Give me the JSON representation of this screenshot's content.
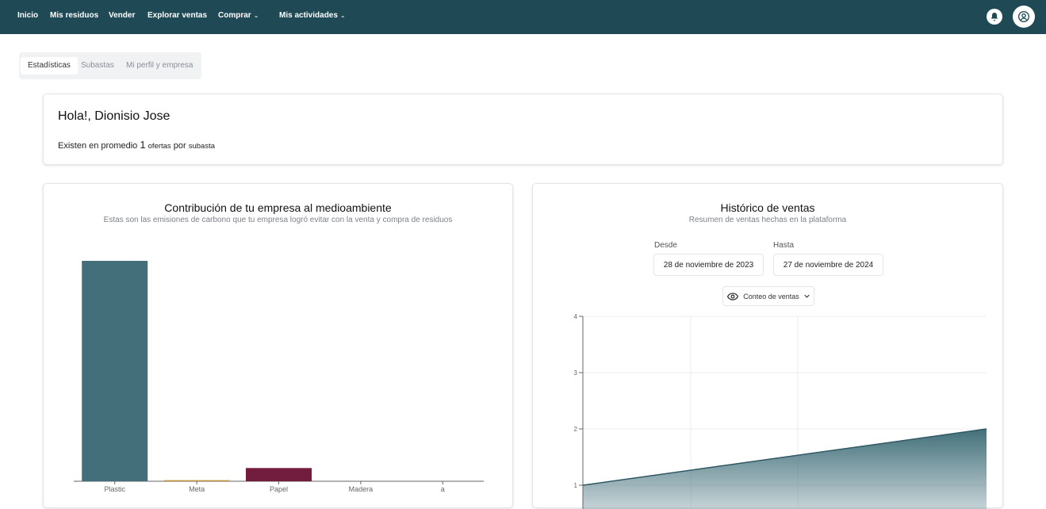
{
  "nav": {
    "items": [
      "Inicio",
      "Mis residuos",
      "Vender",
      "Explorar ventas"
    ],
    "comprar": "Comprar",
    "mis_actividades": "Mis actividades",
    "chevron": "⌄"
  },
  "icons": {
    "bell": "bell-icon",
    "profile": "user-circle-icon",
    "eye": "eye-icon",
    "chevron": "chevron-down-icon"
  },
  "tabs": [
    "Estadísticas",
    "Subastas",
    "Mi perfil y empresa"
  ],
  "greeting": {
    "title": "Hola!, Dionisio Jose",
    "prefix": "Existen en promedio",
    "number": "1",
    "suffix_a": "ofertas",
    "suffix_b": "por",
    "suffix_c": "subasta"
  },
  "contribution": {
    "title": "Contribución de tu empresa al medioambiente",
    "subtitle": "Estas son las emisiones de carbono que tu empresa logró evitar con la venta y compra de residuos"
  },
  "history": {
    "title": "Histórico de ventas",
    "subtitle": "Resumen de ventas hechas en la plataforma",
    "from_label": "Desde",
    "from_value": "28 de noviembre de 2023",
    "to_label": "Hasta",
    "to_value": "27 de noviembre de 2024",
    "metric": "Conteo de ventas"
  },
  "colors": {
    "topbar": "#1f4a55",
    "bar_plastic": "#426f7a",
    "bar_metal": "#c8963c",
    "bar_paper": "#721d3e",
    "area": "#426f7a"
  },
  "chart_data": [
    {
      "type": "bar",
      "categories": [
        "Plastic",
        "Meta",
        "Papel",
        "Madera",
        "a"
      ],
      "values": [
        100,
        0.5,
        6,
        0,
        0
      ],
      "colors": [
        "#426f7a",
        "#c8963c",
        "#721d3e",
        "#cccccc",
        "#cccccc"
      ],
      "ylim": [
        0,
        100
      ]
    },
    {
      "type": "area",
      "x": [
        0,
        1
      ],
      "values": [
        1,
        2
      ],
      "yticks": [
        1,
        2,
        3,
        4
      ],
      "ylim": [
        1,
        4
      ],
      "grid": true
    }
  ]
}
